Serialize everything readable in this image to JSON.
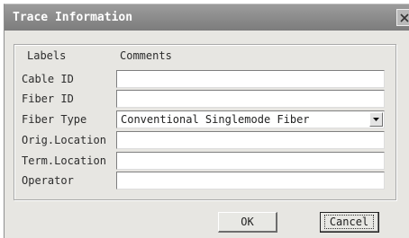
{
  "window": {
    "title": "Trace Information",
    "close_icon": "close-icon"
  },
  "columns": {
    "labels": "Labels",
    "comments": "Comments"
  },
  "rows": [
    {
      "label": "Cable ID",
      "value": ""
    },
    {
      "label": "Fiber ID",
      "value": ""
    },
    {
      "label": "Fiber Type",
      "value": "Conventional Singlemode Fiber"
    },
    {
      "label": "Orig.Location",
      "value": ""
    },
    {
      "label": "Term.Location",
      "value": ""
    },
    {
      "label": "Operator",
      "value": ""
    }
  ],
  "buttons": {
    "ok": "OK",
    "cancel": "Cancel"
  }
}
